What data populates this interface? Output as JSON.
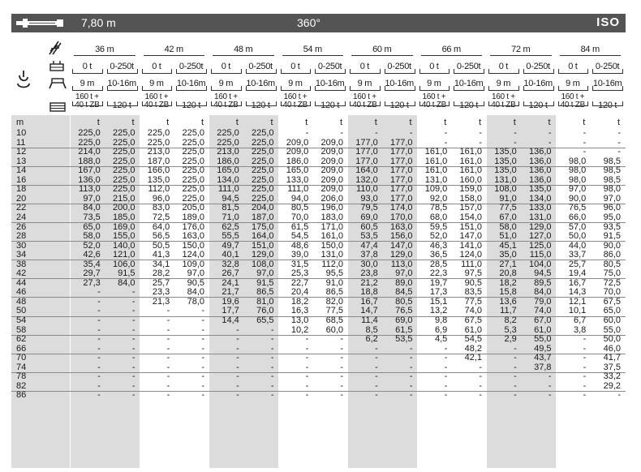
{
  "header": {
    "boom_length": "7,80 m",
    "slew": "360°",
    "standard": "ISO"
  },
  "icons": [
    "jib-icon",
    "lattice-boom-icon",
    "counterweight-icon",
    "outrigger-icon",
    "hook-block-icon",
    "ballast-stack-icon"
  ],
  "columns": [
    {
      "boom": "36 m",
      "sub": [
        {
          "ctr": "0 t",
          "span": "9 m",
          "ball": "160 t +\n40 t ZB"
        },
        {
          "ctr": "0-250t",
          "span": "10-16m",
          "ball": "120 t"
        }
      ]
    },
    {
      "boom": "42 m",
      "sub": [
        {
          "ctr": "0 t",
          "span": "9 m",
          "ball": "160 t +\n40 t ZB"
        },
        {
          "ctr": "0-250t",
          "span": "10-16m",
          "ball": "120 t"
        }
      ]
    },
    {
      "boom": "48 m",
      "sub": [
        {
          "ctr": "0 t",
          "span": "9 m",
          "ball": "160 t +\n40 t ZB"
        },
        {
          "ctr": "0-250t",
          "span": "10-16m",
          "ball": "120 t"
        }
      ]
    },
    {
      "boom": "54 m",
      "sub": [
        {
          "ctr": "0 t",
          "span": "9 m",
          "ball": "160 t +\n40 t ZB"
        },
        {
          "ctr": "0-250t",
          "span": "10-16m",
          "ball": "120 t"
        }
      ]
    },
    {
      "boom": "60 m",
      "sub": [
        {
          "ctr": "0 t",
          "span": "9 m",
          "ball": "160 t +\n40 t ZB"
        },
        {
          "ctr": "0-250t",
          "span": "10-16m",
          "ball": "120 t"
        }
      ]
    },
    {
      "boom": "66 m",
      "sub": [
        {
          "ctr": "0 t",
          "span": "9 m",
          "ball": "160 t +\n40 t ZB"
        },
        {
          "ctr": "0-250t",
          "span": "10-16m",
          "ball": "120 t"
        }
      ]
    },
    {
      "boom": "72 m",
      "sub": [
        {
          "ctr": "0 t",
          "span": "9 m",
          "ball": "160 t +\n40 t ZB"
        },
        {
          "ctr": "0-250t",
          "span": "10-16m",
          "ball": "120 t"
        }
      ]
    },
    {
      "boom": "84 m",
      "sub": [
        {
          "ctr": "0 t",
          "span": "9 m",
          "ball": "160 t +\n40 t ZB"
        },
        {
          "ctr": "0-250t",
          "span": "10-16m",
          "ball": "120 t"
        }
      ]
    }
  ],
  "unit_row": {
    "radius_unit": "m",
    "load_unit": "t"
  },
  "rows": [
    {
      "r": "10",
      "v": [
        "225,0",
        "225,0",
        "225,0",
        "225,0",
        "225,0",
        "225,0",
        "-",
        "-",
        "-",
        "-",
        "-",
        "-",
        "-",
        "-",
        "-",
        "-"
      ]
    },
    {
      "r": "11",
      "v": [
        "225,0",
        "225,0",
        "225,0",
        "225,0",
        "225,0",
        "225,0",
        "209,0",
        "209,0",
        "177,0",
        "177,0",
        "-",
        "-",
        "-",
        "-",
        "-",
        "-"
      ]
    },
    {
      "r": "12",
      "v": [
        "214,0",
        "225,0",
        "213,0",
        "225,0",
        "213,0",
        "225,0",
        "209,0",
        "209,0",
        "177,0",
        "177,0",
        "161,0",
        "161,0",
        "135,0",
        "136,0",
        "-",
        "-"
      ]
    },
    {
      "r": "13",
      "v": [
        "188,0",
        "225,0",
        "187,0",
        "225,0",
        "186,0",
        "225,0",
        "186,0",
        "209,0",
        "177,0",
        "177,0",
        "161,0",
        "161,0",
        "135,0",
        "136,0",
        "98,0",
        "98,5"
      ]
    },
    {
      "r": "14",
      "v": [
        "167,0",
        "225,0",
        "166,0",
        "225,0",
        "165,0",
        "225,0",
        "165,0",
        "209,0",
        "164,0",
        "177,0",
        "161,0",
        "161,0",
        "135,0",
        "136,0",
        "98,0",
        "98,5"
      ]
    },
    {
      "r": "16",
      "v": [
        "136,0",
        "225,0",
        "135,0",
        "225,0",
        "134,0",
        "225,0",
        "133,0",
        "209,0",
        "132,0",
        "177,0",
        "131,0",
        "160,0",
        "131,0",
        "136,0",
        "98,0",
        "98,5"
      ]
    },
    {
      "r": "18",
      "v": [
        "113,0",
        "225,0",
        "112,0",
        "225,0",
        "111,0",
        "225,0",
        "111,0",
        "209,0",
        "110,0",
        "177,0",
        "109,0",
        "159,0",
        "108,0",
        "135,0",
        "97,0",
        "98,0"
      ]
    },
    {
      "r": "20",
      "v": [
        "97,0",
        "215,0",
        "96,0",
        "225,0",
        "94,5",
        "225,0",
        "94,0",
        "206,0",
        "93,0",
        "177,0",
        "92,0",
        "158,0",
        "91,0",
        "134,0",
        "90,0",
        "97,0"
      ]
    },
    {
      "r": "22",
      "v": [
        "84,0",
        "200,0",
        "83,0",
        "205,0",
        "81,5",
        "204,0",
        "80,5",
        "196,0",
        "79,5",
        "174,0",
        "78,5",
        "157,0",
        "77,5",
        "133,0",
        "76,5",
        "96,0"
      ]
    },
    {
      "r": "24",
      "v": [
        "73,5",
        "185,0",
        "72,5",
        "189,0",
        "71,0",
        "187,0",
        "70,0",
        "183,0",
        "69,0",
        "170,0",
        "68,0",
        "154,0",
        "67,0",
        "131,0",
        "66,0",
        "95,0"
      ]
    },
    {
      "r": "26",
      "v": [
        "65,0",
        "169,0",
        "64,0",
        "176,0",
        "62,5",
        "175,0",
        "61,5",
        "171,0",
        "60,5",
        "163,0",
        "59,5",
        "151,0",
        "58,0",
        "129,0",
        "57,0",
        "93,5"
      ]
    },
    {
      "r": "28",
      "v": [
        "58,0",
        "155,0",
        "56,5",
        "163,0",
        "55,5",
        "164,0",
        "54,5",
        "161,0",
        "53,5",
        "156,0",
        "52,0",
        "147,0",
        "51,0",
        "127,0",
        "50,0",
        "91,5"
      ]
    },
    {
      "r": "30",
      "v": [
        "52,0",
        "140,0",
        "50,5",
        "150,0",
        "49,7",
        "151,0",
        "48,6",
        "150,0",
        "47,4",
        "147,0",
        "46,3",
        "141,0",
        "45,1",
        "125,0",
        "44,0",
        "90,0"
      ]
    },
    {
      "r": "34",
      "v": [
        "42,6",
        "121,0",
        "41,3",
        "124,0",
        "40,1",
        "129,0",
        "39,0",
        "131,0",
        "37,8",
        "129,0",
        "36,5",
        "124,0",
        "35,0",
        "115,0",
        "33,7",
        "86,0"
      ]
    },
    {
      "r": "38",
      "v": [
        "35,4",
        "106,0",
        "34,1",
        "109,0",
        "32,8",
        "108,0",
        "31,5",
        "112,0",
        "30,0",
        "113,0",
        "28,5",
        "111,0",
        "27,1",
        "104,0",
        "25,7",
        "80,5"
      ]
    },
    {
      "r": "42",
      "v": [
        "29,7",
        "91,5",
        "28,2",
        "97,0",
        "26,7",
        "97,0",
        "25,3",
        "95,5",
        "23,8",
        "97,0",
        "22,3",
        "97,5",
        "20,8",
        "94,5",
        "19,4",
        "75,0"
      ]
    },
    {
      "r": "44",
      "v": [
        "27,3",
        "84,0",
        "25,7",
        "90,5",
        "24,1",
        "91,5",
        "22,7",
        "91,0",
        "21,2",
        "89,0",
        "19,7",
        "90,5",
        "18,2",
        "89,5",
        "16,7",
        "72,5"
      ]
    },
    {
      "r": "46",
      "v": [
        "-",
        "-",
        "23,3",
        "84,0",
        "21,7",
        "86,5",
        "20,4",
        "86,5",
        "18,8",
        "84,5",
        "17,3",
        "83,5",
        "15,8",
        "84,0",
        "14,3",
        "70,0"
      ]
    },
    {
      "r": "48",
      "v": [
        "-",
        "-",
        "21,3",
        "78,0",
        "19,6",
        "81,0",
        "18,2",
        "82,0",
        "16,7",
        "80,5",
        "15,1",
        "77,5",
        "13,6",
        "79,0",
        "12,1",
        "67,5"
      ]
    },
    {
      "r": "50",
      "v": [
        "-",
        "-",
        "-",
        "-",
        "17,7",
        "76,0",
        "16,3",
        "77,5",
        "14,7",
        "76,5",
        "13,2",
        "74,0",
        "11,7",
        "74,0",
        "10,1",
        "65,0"
      ]
    },
    {
      "r": "54",
      "v": [
        "-",
        "-",
        "-",
        "-",
        "14,4",
        "65,5",
        "13,0",
        "68,5",
        "11,4",
        "69,0",
        "9,8",
        "67,5",
        "8,2",
        "67,0",
        "6,7",
        "60,0"
      ]
    },
    {
      "r": "58",
      "v": [
        "-",
        "-",
        "-",
        "-",
        "-",
        "-",
        "10,2",
        "60,0",
        "8,5",
        "61,5",
        "6,9",
        "61,0",
        "5,3",
        "61,0",
        "3,8",
        "55,0"
      ]
    },
    {
      "r": "62",
      "v": [
        "-",
        "-",
        "-",
        "-",
        "-",
        "-",
        "-",
        "-",
        "6,2",
        "53,5",
        "4,5",
        "54,5",
        "2,9",
        "55,0",
        "-",
        "50,0"
      ]
    },
    {
      "r": "66",
      "v": [
        "-",
        "-",
        "-",
        "-",
        "-",
        "-",
        "-",
        "-",
        "-",
        "-",
        "-",
        "48,2",
        "-",
        "49,5",
        "-",
        "46,0"
      ]
    },
    {
      "r": "70",
      "v": [
        "-",
        "-",
        "-",
        "-",
        "-",
        "-",
        "-",
        "-",
        "-",
        "-",
        "-",
        "42,1",
        "-",
        "43,7",
        "-",
        "41,7"
      ]
    },
    {
      "r": "74",
      "v": [
        "-",
        "-",
        "-",
        "-",
        "-",
        "-",
        "-",
        "-",
        "-",
        "-",
        "-",
        "-",
        "-",
        "37,8",
        "-",
        "37,5"
      ]
    },
    {
      "r": "78",
      "v": [
        "-",
        "-",
        "-",
        "-",
        "-",
        "-",
        "-",
        "-",
        "-",
        "-",
        "-",
        "-",
        "-",
        "-",
        "-",
        "33,2"
      ]
    },
    {
      "r": "82",
      "v": [
        "-",
        "-",
        "-",
        "-",
        "-",
        "-",
        "-",
        "-",
        "-",
        "-",
        "-",
        "-",
        "-",
        "-",
        "-",
        "29,2"
      ]
    },
    {
      "r": "86",
      "v": [
        "-",
        "-",
        "-",
        "-",
        "-",
        "-",
        "-",
        "-",
        "-",
        "-",
        "-",
        "-",
        "-",
        "-",
        "-",
        "-"
      ]
    }
  ]
}
